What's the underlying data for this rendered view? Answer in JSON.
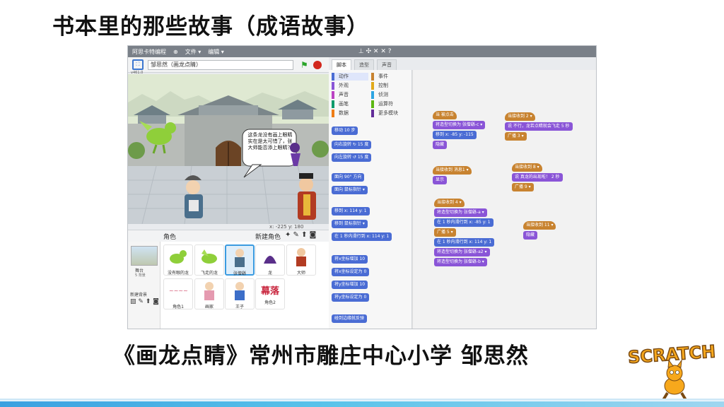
{
  "slide": {
    "title": "书本里的那些故事（成语故事）",
    "caption": "《画龙点睛》常州市雕庄中心小学 邹思然"
  },
  "editor": {
    "menu": {
      "app": "阿思卡特编程",
      "file": "文件 ▾",
      "edit": "编辑 ▾",
      "tools": "⊥ ✣ ✕ ✕ ?"
    },
    "project_name": "邹思然（画龙点睛）",
    "version": "v461.0",
    "coords": "x: -225  y: 180",
    "tabs": [
      "脚本",
      "造型",
      "声音"
    ],
    "categories": [
      {
        "label": "动作",
        "color": "#4a6cd4"
      },
      {
        "label": "事件",
        "color": "#c88330"
      },
      {
        "label": "外观",
        "color": "#8a55d7"
      },
      {
        "label": "控制",
        "color": "#e1a91a"
      },
      {
        "label": "声音",
        "color": "#bb42c3"
      },
      {
        "label": "侦测",
        "color": "#2ca5e2"
      },
      {
        "label": "画笔",
        "color": "#0e9a6c"
      },
      {
        "label": "运算符",
        "color": "#5cb712"
      },
      {
        "label": "数据",
        "color": "#ee7d16"
      },
      {
        "label": "更多模块",
        "color": "#632d99"
      }
    ],
    "palette_blocks": [
      "移动 10 步",
      "向右旋转 ↻ 15 度",
      "向左旋转 ↺ 15 度",
      "面向 90° 方向",
      "面向 鼠标指针 ▾",
      "移到 x: 114 y: 1",
      "移到 鼠标指针 ▾",
      "在 1 秒内滑行到 x: 114 y: 1",
      "将x坐标增加 10",
      "将x坐标设定为 0",
      "将y坐标增加 10",
      "将y坐标设定为 0",
      "碰到边缘就反弹"
    ],
    "sprite_pane": {
      "header": "角色",
      "new_sprite": "新建角色",
      "stage_name": "舞台",
      "stage_sub": "5 背景",
      "new_backdrop": "新建背景",
      "sprites": [
        "没有眼的龙",
        "飞走的龙",
        "张僧繇",
        "龙",
        "大师",
        "角色1",
        "画家",
        "王子",
        "角色2"
      ],
      "sprite_mu_text": "幕落"
    },
    "bubble": "这条龙没有画上眼睛实在是太可惜了，张大师能否添上眼睛？",
    "scripts": {
      "s1": [
        "当 被点击",
        "将造型切换为 张僧繇-c ▾",
        "移到 x: -85 y: -115",
        "隐藏"
      ],
      "s2": [
        "当接收到 2 ▾",
        "说 不行，龙若点睛就会飞走 5 秒",
        "广播 3 ▾"
      ],
      "s3": [
        "当接收到 消息1 ▾",
        "显示"
      ],
      "s4": [
        "当接收到 8 ▾",
        "说 真龙的出现啦！ 2 秒",
        "广播 9 ▾"
      ],
      "s5": [
        "当接收到 4 ▾",
        "将造型切换为 张僧繇-a ▾",
        "在 1 秒内滑行到 x: -85 y: 1",
        "广播 5 ▾",
        "在 1 秒内滑行到 x: 114 y: 1",
        "将造型切换为 张僧繇-a2 ▾",
        "将造型切换为 张僧繇-b ▾"
      ],
      "s6": [
        "当接收到 11 ▾",
        "隐藏"
      ]
    }
  },
  "logo": {
    "text": "SCRATCH"
  }
}
